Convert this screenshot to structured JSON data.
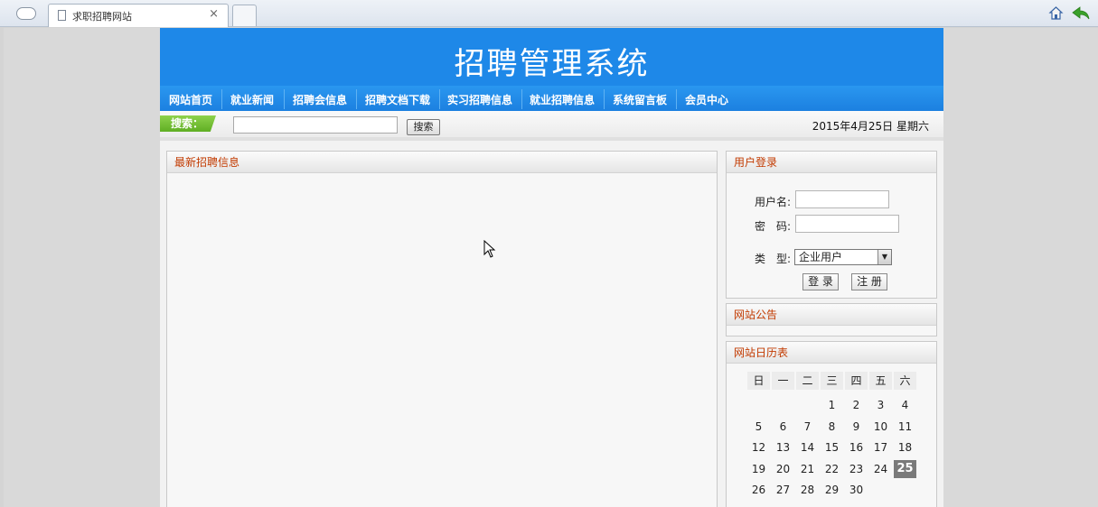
{
  "browser": {
    "tab_title": "求职招聘网站",
    "tab_close": "×"
  },
  "site": {
    "title": "招聘管理系统"
  },
  "nav": [
    "网站首页",
    "就业新闻",
    "招聘会信息",
    "招聘文档下载",
    "实习招聘信息",
    "就业招聘信息",
    "系统留言板",
    "会员中心"
  ],
  "search": {
    "label": "搜索：",
    "button": "搜索",
    "value": ""
  },
  "date": "2015年4月25日 星期六",
  "main": {
    "latest_jobs_title": "最新招聘信息"
  },
  "login": {
    "title": "用户登录",
    "username_label": "用户名:",
    "password_label": "密　码:",
    "type_label": "类　型:",
    "type_selected": "企业用户",
    "login_button": "登 录",
    "register_button": "注 册"
  },
  "notice": {
    "title": "网站公告"
  },
  "calendar": {
    "title": "网站日历表",
    "weekdays": [
      "日",
      "一",
      "二",
      "三",
      "四",
      "五",
      "六"
    ],
    "weeks": [
      [
        "",
        "",
        "",
        "1",
        "2",
        "3",
        "4"
      ],
      [
        "5",
        "6",
        "7",
        "8",
        "9",
        "10",
        "11"
      ],
      [
        "12",
        "13",
        "14",
        "15",
        "16",
        "17",
        "18"
      ],
      [
        "19",
        "20",
        "21",
        "22",
        "23",
        "24",
        "25"
      ],
      [
        "26",
        "27",
        "28",
        "29",
        "30",
        "",
        ""
      ]
    ],
    "today": "25"
  }
}
